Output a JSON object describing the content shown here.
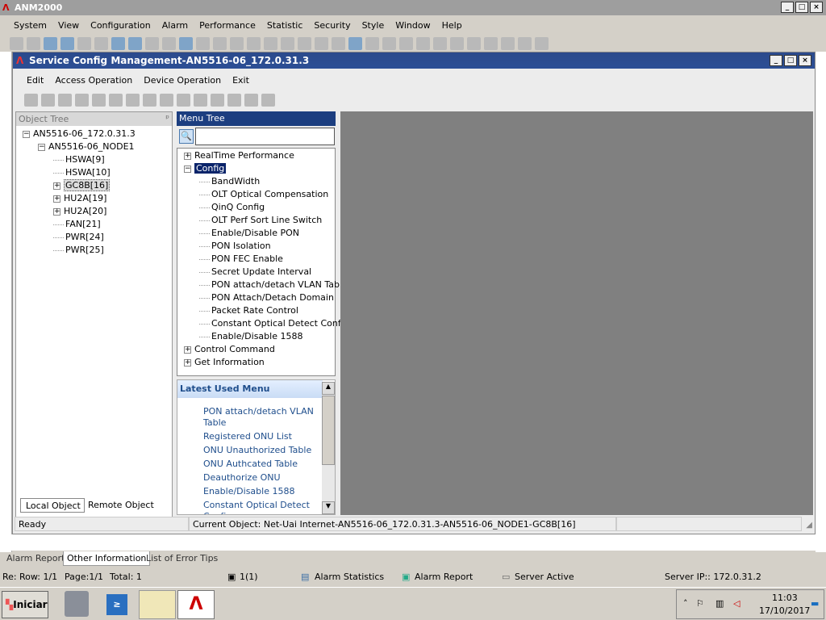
{
  "app": {
    "title": "ANM2000",
    "window_buttons": [
      "_",
      "□",
      "×"
    ]
  },
  "menu": [
    "System",
    "View",
    "Configuration",
    "Alarm",
    "Performance",
    "Statistic",
    "Security",
    "Style",
    "Window",
    "Help"
  ],
  "inner": {
    "title": "Service Config Management-AN5516-06_172.0.31.3",
    "menu": [
      "Edit",
      "Access Operation",
      "Device Operation",
      "Exit"
    ],
    "object_tree": {
      "header": "Object Tree",
      "pin": "ᵖ",
      "items": [
        {
          "label": "AN5516-06_172.0.31.3",
          "level": 0,
          "toggle": "−"
        },
        {
          "label": "AN5516-06_NODE1",
          "level": 1,
          "toggle": "−"
        },
        {
          "label": "HSWA[9]",
          "level": 2,
          "toggle": ""
        },
        {
          "label": "HSWA[10]",
          "level": 2,
          "toggle": ""
        },
        {
          "label": "GC8B[16]",
          "level": 2,
          "toggle": "+",
          "selected": true
        },
        {
          "label": "HU2A[19]",
          "level": 2,
          "toggle": "+"
        },
        {
          "label": "HU2A[20]",
          "level": 2,
          "toggle": "+"
        },
        {
          "label": "FAN[21]",
          "level": 2,
          "toggle": ""
        },
        {
          "label": "PWR[24]",
          "level": 2,
          "toggle": ""
        },
        {
          "label": "PWR[25]",
          "level": 2,
          "toggle": ""
        }
      ],
      "tabs": [
        "Local Object",
        "Remote Object"
      ]
    },
    "menu_tree": {
      "header": "Menu Tree",
      "search_value": "",
      "items": [
        {
          "label": "RealTime Performance",
          "level": 0,
          "toggle": "+"
        },
        {
          "label": "Config",
          "level": 0,
          "toggle": "−",
          "selected": true
        },
        {
          "label": "BandWidth",
          "level": 1
        },
        {
          "label": "OLT Optical Compensation",
          "level": 1
        },
        {
          "label": "QinQ Config",
          "level": 1
        },
        {
          "label": "OLT Perf Sort Line Switch",
          "level": 1
        },
        {
          "label": "Enable/Disable PON",
          "level": 1
        },
        {
          "label": "PON Isolation",
          "level": 1
        },
        {
          "label": "PON FEC Enable",
          "level": 1
        },
        {
          "label": "Secret Update Interval",
          "level": 1
        },
        {
          "label": "PON attach/detach VLAN Table",
          "level": 1
        },
        {
          "label": "PON Attach/Detach Domain",
          "level": 1
        },
        {
          "label": "Packet Rate Control",
          "level": 1
        },
        {
          "label": "Constant Optical Detect Config",
          "level": 1
        },
        {
          "label": "Enable/Disable 1588",
          "level": 1
        },
        {
          "label": "Control Command",
          "level": 0,
          "toggle": "+"
        },
        {
          "label": "Get Information",
          "level": 0,
          "toggle": "+"
        }
      ]
    },
    "latest_used": {
      "header": "Latest Used Menu",
      "items": [
        "PON attach/detach VLAN Table",
        "Registered ONU  List",
        "ONU Unauthorized Table",
        "ONU Authcated Table",
        "Deauthorize ONU",
        "Enable/Disable 1588",
        "Constant Optical Detect Config"
      ]
    },
    "status": {
      "left": "Ready",
      "current_object": "Current Object: Net-Uai Internet-AN5516-06_172.0.31.3-AN5516-06_NODE1-GC8B[16]"
    }
  },
  "bottom_tabs": [
    "Alarm Report",
    "Other Information",
    "List of Error Tips"
  ],
  "active_bottom_tab": "Other Information",
  "statusbar": {
    "prefix": "Re:",
    "row": "Row: 1/1",
    "page": "Page:1/1",
    "total": "Total: 1",
    "users": "1(1)",
    "alarm_stats": "Alarm Statistics",
    "alarm_report": "Alarm Report",
    "server": "Server Active",
    "server_ip": "Server IP:: 172.0.31.2"
  },
  "taskbar": {
    "start": "Iniciar",
    "time": "11:03",
    "date": "17/10/2017"
  },
  "colors": {
    "title_blue": "#2b4a8c",
    "link": "#1f4e8c",
    "gray_area": "#808080"
  }
}
